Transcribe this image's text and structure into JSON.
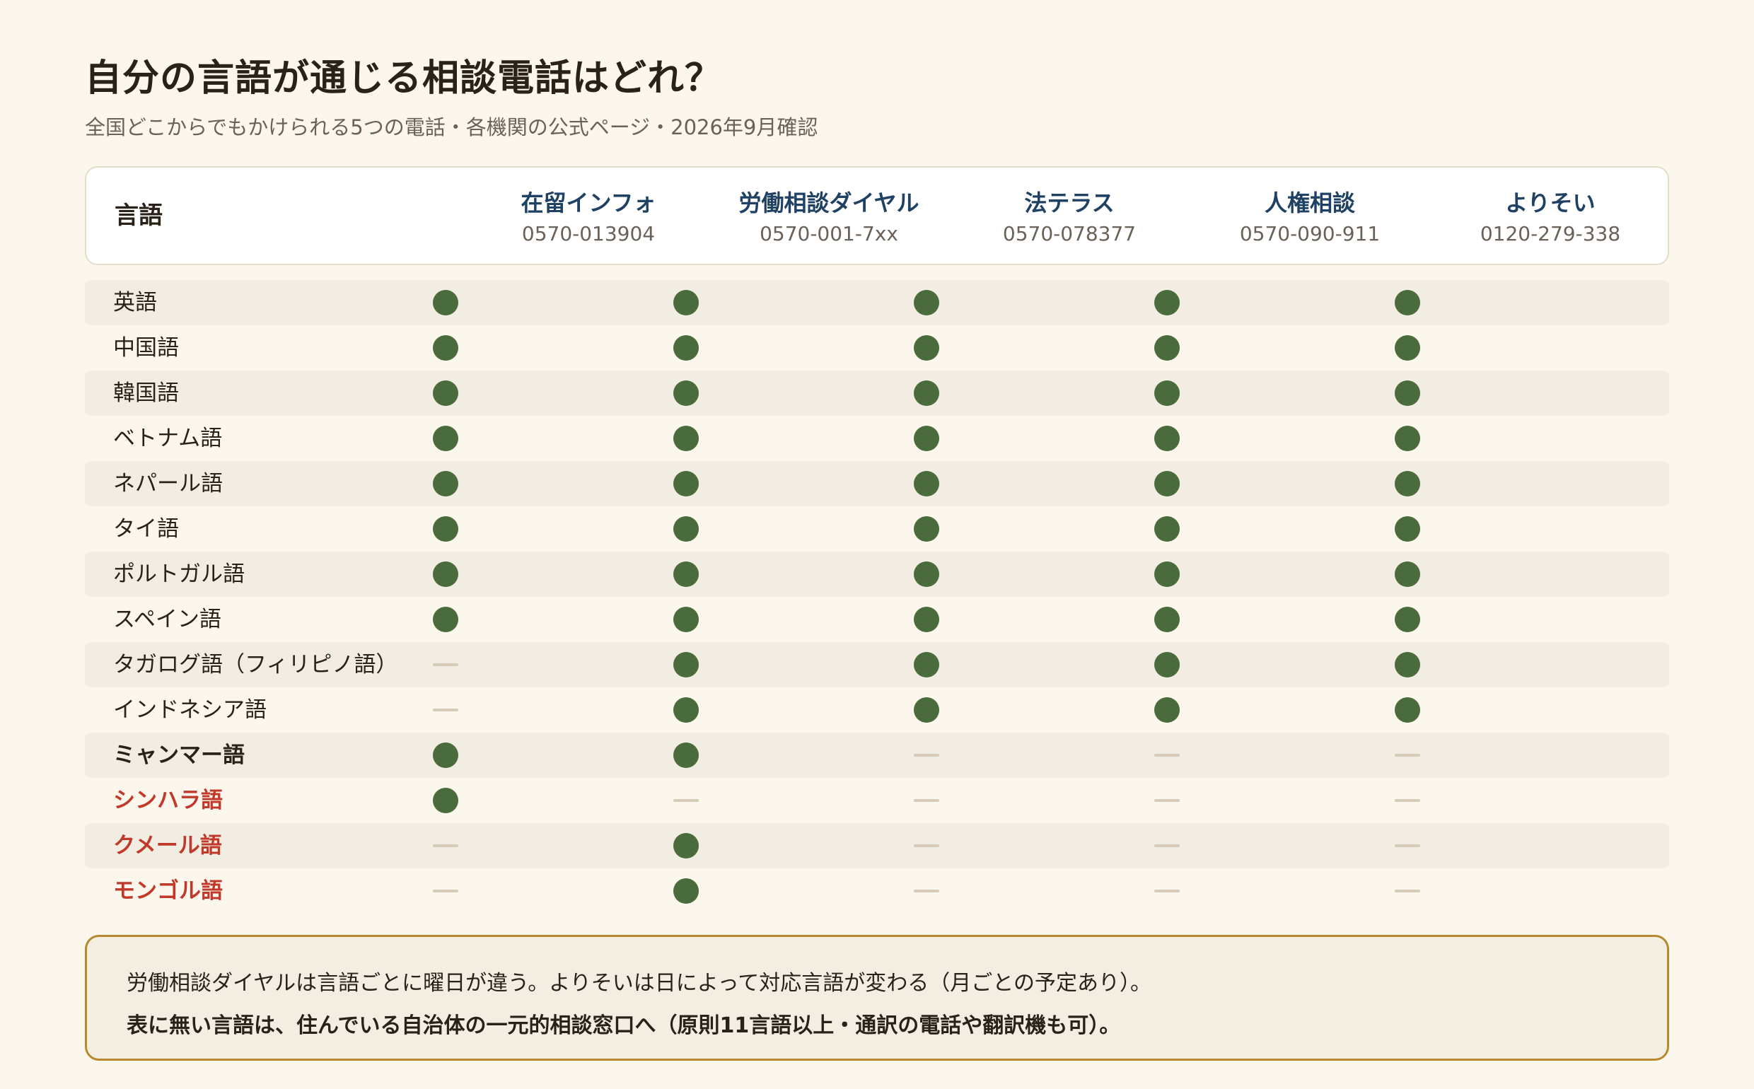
{
  "title": "自分の言語が通じる相談電話はどれ？",
  "subtitle": "全国どこからでもかけられる5つの電話・各機関の公式ページ・2026年9月確認",
  "table": {
    "language_header": "言語",
    "services": [
      {
        "name": "在留インフォ",
        "phone": "0570-013904"
      },
      {
        "name": "労働相談ダイヤル",
        "phone": "0570-001-7xx"
      },
      {
        "name": "法テラス",
        "phone": "0570-078377"
      },
      {
        "name": "人権相談",
        "phone": "0570-090-911"
      },
      {
        "name": "よりそい",
        "phone": "0120-279-338"
      }
    ],
    "rows": [
      {
        "language": "英語",
        "style": "normal",
        "support": [
          true,
          true,
          true,
          true,
          true
        ]
      },
      {
        "language": "中国語",
        "style": "normal",
        "support": [
          true,
          true,
          true,
          true,
          true
        ]
      },
      {
        "language": "韓国語",
        "style": "normal",
        "support": [
          true,
          true,
          true,
          true,
          true
        ]
      },
      {
        "language": "ベトナム語",
        "style": "normal",
        "support": [
          true,
          true,
          true,
          true,
          true
        ]
      },
      {
        "language": "ネパール語",
        "style": "normal",
        "support": [
          true,
          true,
          true,
          true,
          true
        ]
      },
      {
        "language": "タイ語",
        "style": "normal",
        "support": [
          true,
          true,
          true,
          true,
          true
        ]
      },
      {
        "language": "ポルトガル語",
        "style": "normal",
        "support": [
          true,
          true,
          true,
          true,
          true
        ]
      },
      {
        "language": "スペイン語",
        "style": "normal",
        "support": [
          true,
          true,
          true,
          true,
          true
        ]
      },
      {
        "language": "タガログ語（フィリピノ語）",
        "style": "normal",
        "support": [
          false,
          true,
          true,
          true,
          true
        ]
      },
      {
        "language": "インドネシア語",
        "style": "normal",
        "support": [
          false,
          true,
          true,
          true,
          true
        ]
      },
      {
        "language": "ミャンマー語",
        "style": "bold",
        "support": [
          true,
          true,
          false,
          false,
          false
        ]
      },
      {
        "language": "シンハラ語",
        "style": "red",
        "support": [
          true,
          false,
          false,
          false,
          false
        ]
      },
      {
        "language": "クメール語",
        "style": "red",
        "support": [
          false,
          true,
          false,
          false,
          false
        ]
      },
      {
        "language": "モンゴル語",
        "style": "red",
        "support": [
          false,
          true,
          false,
          false,
          false
        ]
      }
    ]
  },
  "note": {
    "line1": "労働相談ダイヤルは言語ごとに曜日が違う。よりそいは日によって対応言語が変わる（月ごとの予定あり）。",
    "line2": "表に無い言語は、住んでいる自治体の一元的相談窓口へ（原則11言語以上・通訳の電話や翻訳機も可）。"
  },
  "colors": {
    "background": "#fbf7ec",
    "supported_dot": "#4a6b3c",
    "unsupported_dash": "#d5cbb8",
    "service_name": "#1f4163",
    "highlight_red": "#c0392b",
    "note_border": "#b88a2f"
  }
}
